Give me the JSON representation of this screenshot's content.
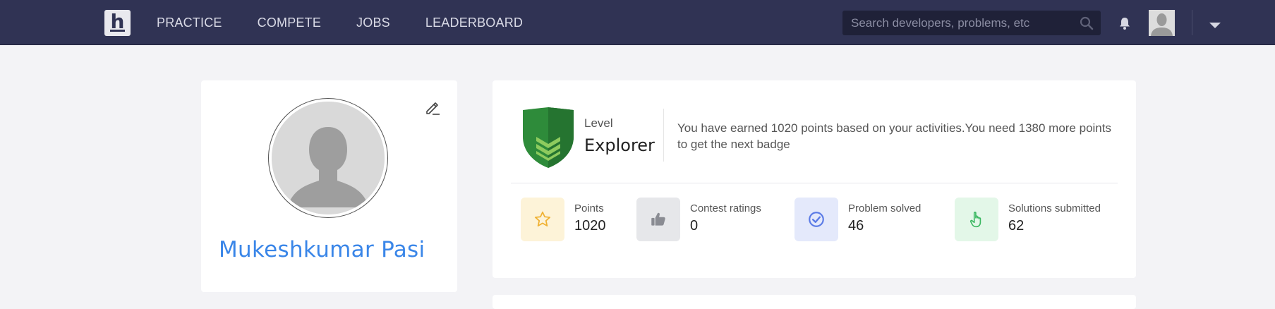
{
  "navbar": {
    "logo_letter": "h",
    "links": [
      "PRACTICE",
      "COMPETE",
      "JOBS",
      "LEADERBOARD"
    ],
    "search_placeholder": "Search developers, problems, etc",
    "icons": [
      "search-icon",
      "bell-icon",
      "avatar",
      "chevron-down-icon"
    ]
  },
  "profile": {
    "name": "Mukeshkumar Pasi",
    "name_color": "#3a86e8"
  },
  "level": {
    "label": "Level",
    "name": "Explorer",
    "message": "You have earned 1020 points based on your activities.You need 1380 more points to get the next badge",
    "badge_color": "#2e8b3a"
  },
  "stats": [
    {
      "label": "Points",
      "value": "1020",
      "icon": "star-icon",
      "bg": "#fdf3d8",
      "fg": "#f0b132"
    },
    {
      "label": "Contest ratings",
      "value": "0",
      "icon": "thumbs-up-icon",
      "bg": "#e6e7ea",
      "fg": "#8a8c93"
    },
    {
      "label": "Problem solved",
      "value": "46",
      "icon": "check-circle-icon",
      "bg": "#e4e9fb",
      "fg": "#5b7be6"
    },
    {
      "label": "Solutions submitted",
      "value": "62",
      "icon": "hand-pointer-icon",
      "bg": "#e3f7e8",
      "fg": "#3cb862"
    }
  ]
}
